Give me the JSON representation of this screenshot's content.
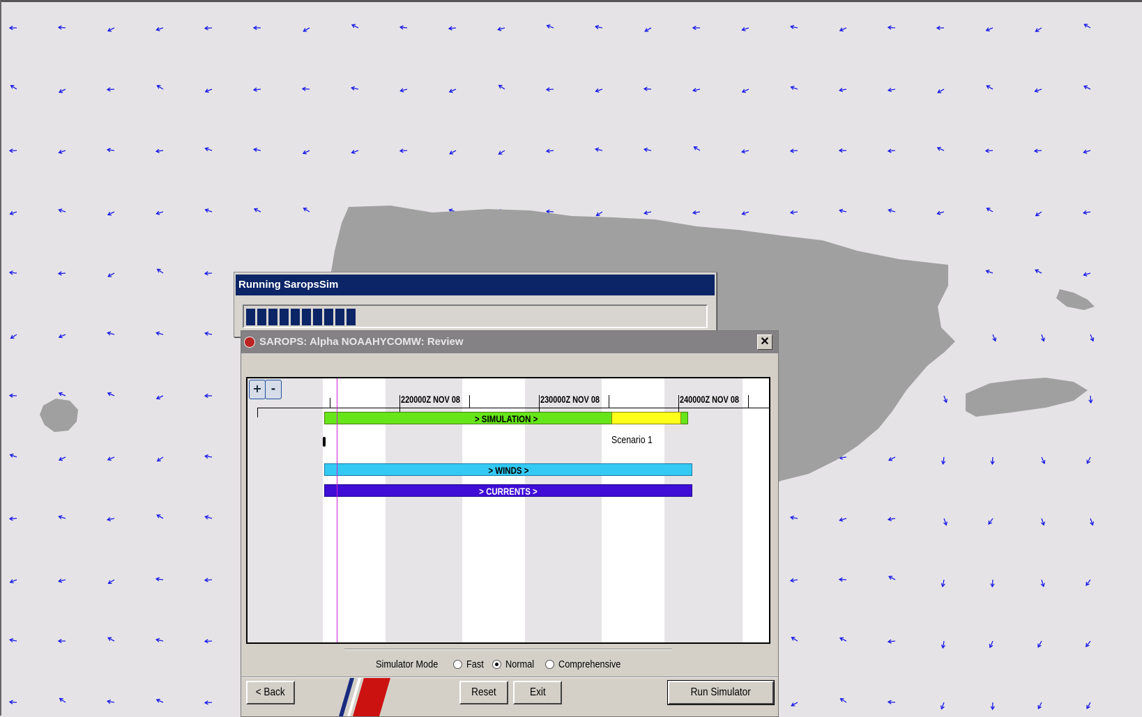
{
  "progress_window": {
    "title": "Running SaropsSim",
    "progress_blocks": 10,
    "progress_fraction": 0.18
  },
  "review_window": {
    "title": "SAROPS: Alpha NOAAHYCOMW: Review",
    "close_label": "✕"
  },
  "timeline": {
    "zoom_in_label": "+",
    "zoom_out_label": "-",
    "dates": [
      "220000Z NOV 08",
      "230000Z NOV 08",
      "240000Z NOV 08"
    ],
    "simulation_label": "> SIMULATION >",
    "scenario_label": "Scenario 1",
    "winds_label": "> WINDS >",
    "currents_label": "> CURRENTS >",
    "colors": {
      "simulation": "#66e61a",
      "simulation_tail": "#ffff1a",
      "winds": "#33c9f2",
      "currents": "#3f0dd6",
      "cursor": "#d020d0"
    }
  },
  "simulator_mode": {
    "label": "Simulator Mode",
    "options": [
      "Fast",
      "Normal",
      "Comprehensive"
    ],
    "selected": "Normal"
  },
  "buttons": {
    "back": "< Back",
    "reset": "Reset",
    "exit": "Exit",
    "run": "Run Simulator"
  },
  "map": {
    "land_color": "#a0a0a0",
    "water_color": "#e6e3e6",
    "arrow_color": "#1a1ae6"
  }
}
